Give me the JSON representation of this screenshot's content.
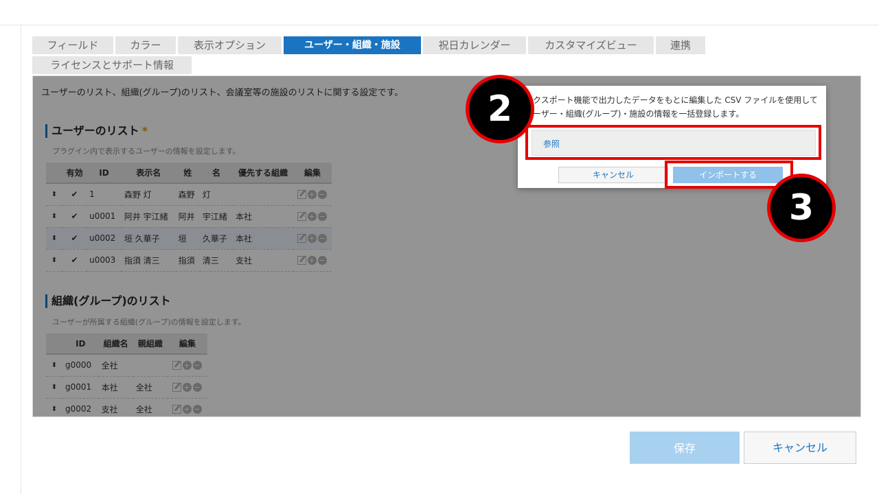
{
  "tabs": [
    "フィールド",
    "カラー",
    "表示オプション",
    "ユーザー・組織・施設",
    "祝日カレンダー",
    "カスタマイズビュー",
    "連携",
    "ライセンスとサポート情報"
  ],
  "active_tab": "ユーザー・組織・施設",
  "panel": {
    "description": "ユーザーのリスト、組織(グループ)のリスト、会議室等の施設のリストに関する設定です。",
    "users": {
      "title": "ユーザーのリスト",
      "required_mark": "*",
      "subtitle": "プラグイン内で表示するユーザーの情報を設定します。",
      "headers": [
        "有効",
        "ID",
        "表示名",
        "姓",
        "名",
        "優先する組織",
        "編集"
      ],
      "rows": [
        {
          "id": "1",
          "display": "森野 灯",
          "last": "森野",
          "first": "灯",
          "org": ""
        },
        {
          "id": "u0001",
          "display": "阿井 宇江緒",
          "last": "阿井",
          "first": "宇江緒",
          "org": "本社"
        },
        {
          "id": "u0002",
          "display": "垣 久華子",
          "last": "垣",
          "first": "久華子",
          "org": "本社"
        },
        {
          "id": "u0003",
          "display": "指須 清三",
          "last": "指須",
          "first": "清三",
          "org": "支社"
        }
      ]
    },
    "groups": {
      "title": "組織(グループ)のリスト",
      "subtitle": "ユーザーが所属する組織(グループ)の情報を設定します。",
      "headers": [
        "ID",
        "組織名",
        "親組織",
        "編集"
      ],
      "rows": [
        {
          "id": "g0000",
          "name": "全社",
          "parent": ""
        },
        {
          "id": "g0001",
          "name": "本社",
          "parent": "全社"
        },
        {
          "id": "g0002",
          "name": "支社",
          "parent": "全社"
        }
      ]
    }
  },
  "dialog": {
    "line1": "クスポート機能で出力したデータをもとに編集した CSV ファイルを使用して",
    "line2": "ーザー・組織(グループ)・施設の情報を一括登録します。",
    "browse_label": "参照",
    "cancel_label": "キャンセル",
    "import_label": "インポートする"
  },
  "annotations": {
    "badge_2": "2",
    "badge_3": "3",
    "color": "#e60000"
  },
  "footer": {
    "save_label": "保存",
    "cancel_label": "キャンセル"
  },
  "colors": {
    "accent": "#1a74c2",
    "save_button": "#a8d0ef",
    "import_button": "#8fc1ea",
    "check": "#c0392b"
  }
}
